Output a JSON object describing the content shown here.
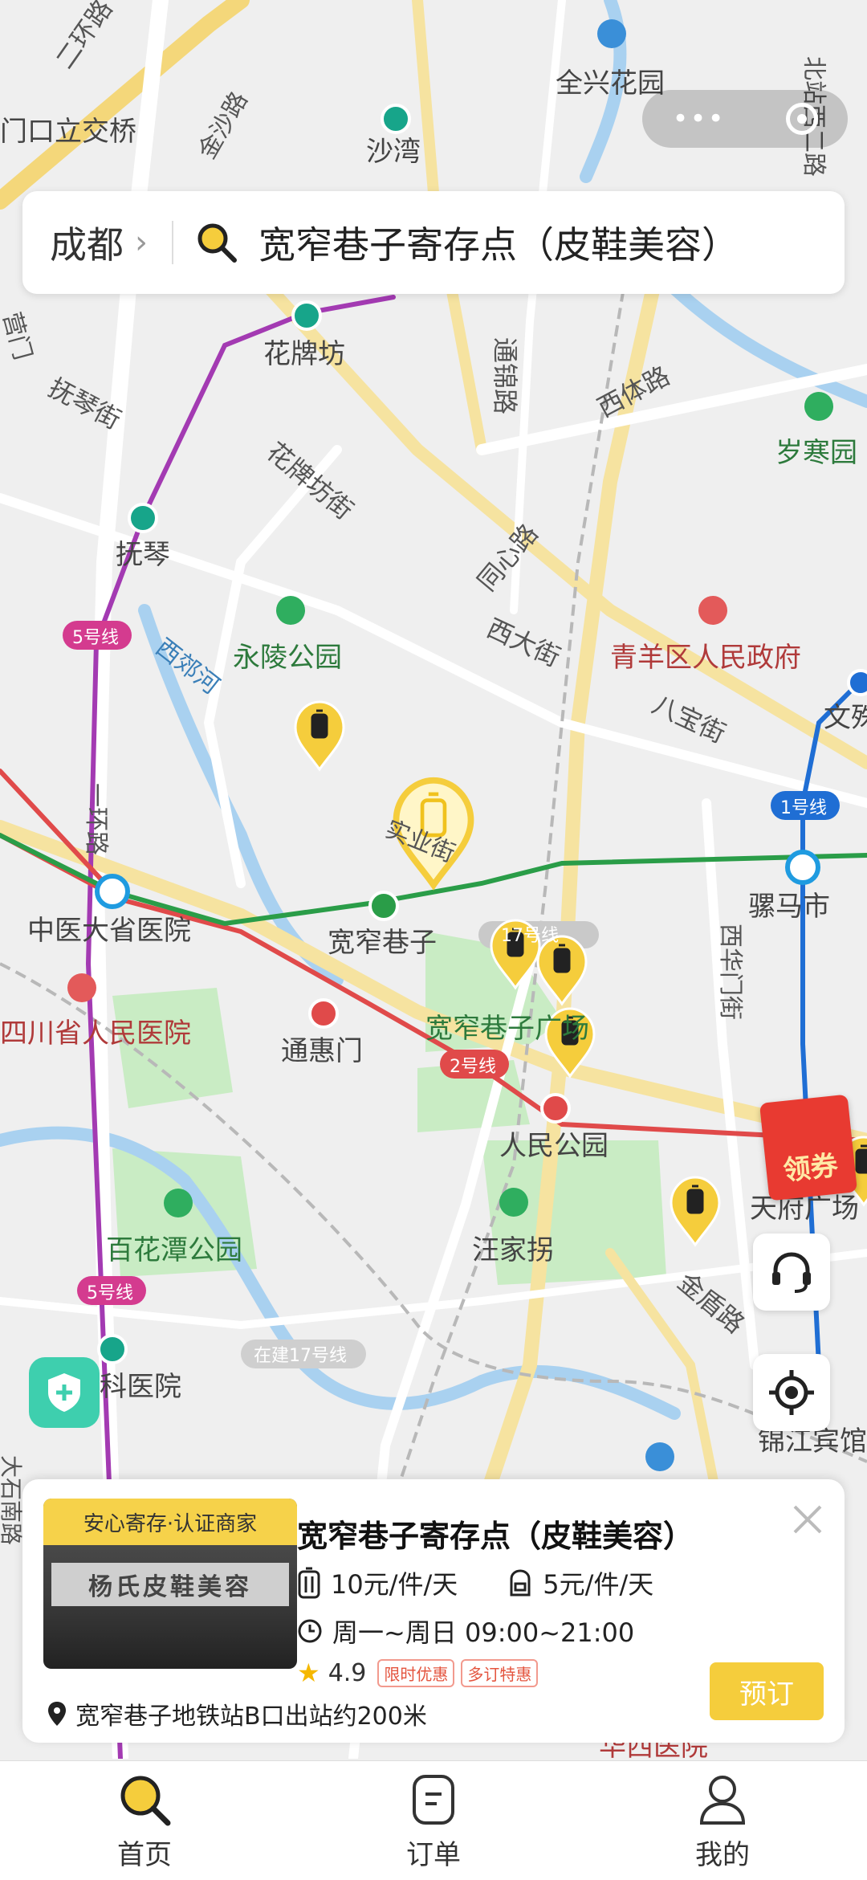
{
  "top_capsule": {
    "menu_icon": "more-dots-icon",
    "close_icon": "target-circle-icon"
  },
  "search": {
    "city": "成都",
    "query": "宽窄巷子寄存点（皮鞋美容）"
  },
  "map": {
    "labels": {
      "ring2_road": "二环路",
      "quanxing_garden": "全兴花园",
      "interchange": "门口立交桥",
      "jinsha_road": "金沙路",
      "shawan": "沙湾",
      "beizhan_west": "北站西二路",
      "huapaifang_station": "花牌坊",
      "tongjin_road": "通锦路",
      "xiti_road": "西体路",
      "yingmen": "营门",
      "fuqin_street": "抚琴街",
      "suihan_garden": "岁寒园",
      "huapaifang_street": "花牌坊街",
      "fuqin_station": "抚琴",
      "tongxin_road": "同心路",
      "xida_street": "西大街",
      "qingyang_gov": "青羊区人民政府",
      "yongling_park": "永陵公园",
      "xijiao_river": "西郊河",
      "line5": "5号线",
      "wenshu": "文殊",
      "babao_street": "八宝街",
      "line1": "1号线",
      "ring1_road": "一环路",
      "shenxian_street": "实业街",
      "zhongyi_hospital": "中医大省医院",
      "kuanzhai_station": "宽窄巷子",
      "line17": "17号线",
      "luoma_market": "骡马市",
      "xihuamen_street": "西华门街",
      "sichuan_hospital": "四川省人民医院",
      "tonghuimen": "通惠门",
      "kuanzhai_square": "宽窄巷子广场",
      "line2": "2号线",
      "renmin_park": "人民公园",
      "tianfu_square": "天府广场",
      "baihuatan_park": "百花潭公园",
      "wangjiaguai": "汪家拐",
      "jindun_road": "金盾路",
      "line5b": "5号线",
      "under_construction_17": "在建17号线",
      "keyiyuan": "科医院",
      "jinjiang_hotel": "锦江宾馆",
      "dashi_road": "大石南路",
      "huaxi_hospital": "华西医院"
    },
    "coupon_label": "领券"
  },
  "card": {
    "tag": "安心寄存·认证商家",
    "shop_sign": "杨氏皮鞋美容",
    "title": "宽窄巷子寄存点（皮鞋美容）",
    "price_large": "10元/件/天",
    "price_small": "5元/件/天",
    "hours": "周一~周日 09:00~21:00",
    "rating": "4.9",
    "badge1": "限时优惠",
    "badge2": "多订特惠",
    "address": "宽窄巷子地铁站B口出站约200米",
    "book_label": "预订"
  },
  "nav": {
    "home": "首页",
    "orders": "订单",
    "mine": "我的"
  },
  "colors": {
    "brand_yellow": "#f5cd3c",
    "line5": "#a33ab2",
    "line2": "#e04a4a",
    "line4": "#2a9d48",
    "line1": "#1f6ed4"
  }
}
